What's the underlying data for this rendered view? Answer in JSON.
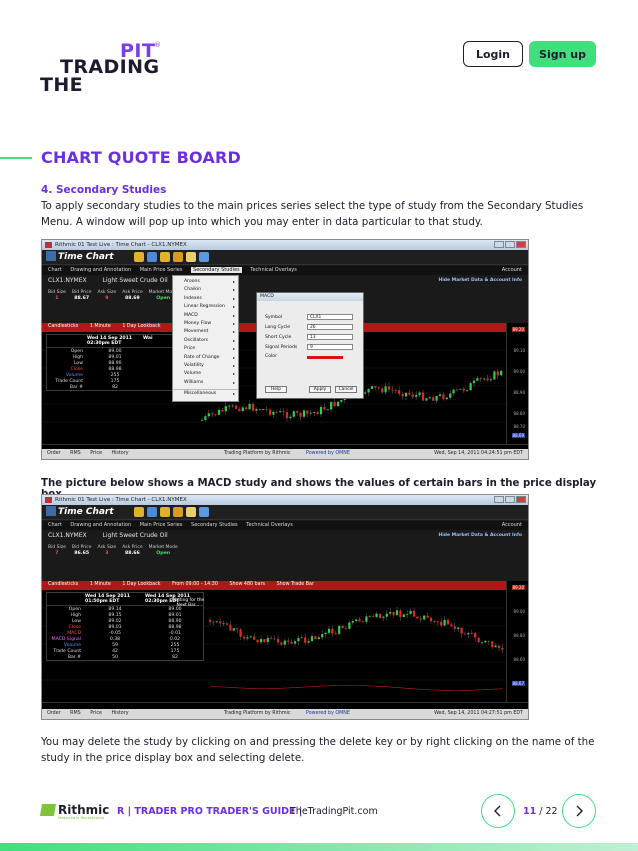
{
  "header": {
    "logo_pit": "PIT",
    "logo_reg": "®",
    "logo_trading": "TRADING",
    "logo_the": "THE",
    "login_label": "Login",
    "signup_label": "Sign up"
  },
  "content": {
    "page_title": "CHART QUOTE BOARD",
    "section_heading": "4. Secondary Studies",
    "paragraph1": "To apply secondary studies to the main prices series select the type  of study  from  the Secondary Studies Menu. A window will pop up into which you may enter in data particular to that study.",
    "caption": "The picture below shows a MACD study and shows the values of certain bars in the price display box.",
    "paragraph2": "You may delete the study by clicking on and pressing the delete key or by right clicking on the name of the study in the price display box and selecting delete."
  },
  "screenshot1": {
    "window_title": "Rithmic 01 Test Live : Time Chart - CLX1.NYMEX",
    "app_name": "Time Chart",
    "menu": [
      "Chart",
      "Drawing and Annotation",
      "Main Price Series",
      "Secondary Studies",
      "Technical Overlays"
    ],
    "menu_account": "Account",
    "symbol": "CLX1.NYMEX",
    "description": "Light Sweet Crude Oil",
    "hide_link": "Hide Market Data & Account Info",
    "quote_labels": [
      "Bid Size",
      "Bid Price",
      "Ask Size",
      "Ask Price",
      "Market Mode"
    ],
    "quote_values": [
      "1",
      "88.67",
      "9",
      "88.69",
      "Open"
    ],
    "ctrl": [
      "Candlesticks",
      "1 Minute",
      "1 Day Lookback"
    ],
    "dropdown_items": [
      "Aroons",
      "Chaikin",
      "Indexes",
      "Linear Regression",
      "MACD",
      "Money Flow",
      "Movement",
      "Oscillators",
      "Price",
      "Rate of Change",
      "Volatility",
      "Volume",
      "Williams",
      "Miscellaneous"
    ],
    "dialog": {
      "title": "MACD",
      "symbol_label": "Symbol",
      "symbol_value": "CLX1",
      "long_label": "Long Cycle",
      "long_value": "26",
      "short_label": "Short Cycle",
      "short_value": "13",
      "signal_label": "Signal Periods",
      "signal_value": "9",
      "color_label": "Color",
      "help": "Help",
      "apply": "Apply",
      "cancel": "Cancel"
    },
    "pricebox": {
      "col1": "Wed 14 Sep 2011 02:30pm EDT",
      "col2": "Wai",
      "rows": [
        [
          "Open",
          "89.00"
        ],
        [
          "High",
          "89.01"
        ],
        [
          "Low",
          "88.90"
        ],
        [
          "Close",
          "88.98"
        ],
        [
          "Volume",
          "255"
        ],
        [
          "Trade Count",
          "175"
        ],
        [
          "Bar #",
          "82"
        ]
      ]
    },
    "axis": [
      "89.20",
      "89.10",
      "89.00",
      "88.90",
      "88.80",
      "88.70",
      "88.69"
    ],
    "status": [
      "Order",
      "RMS",
      "Price",
      "History"
    ],
    "status_mid": "Trading Platform by Rithmic",
    "status_mid2": "Powered by OMNE",
    "status_right": "Wed, Sep 14, 2011 04:24:51 pm EDT"
  },
  "screenshot2": {
    "window_title": "Rithmic 01 Test Live : Time Chart - CLX1.NYMEX",
    "app_name": "Time Chart",
    "menu": [
      "Chart",
      "Drawing and Annotation",
      "Main Price Series",
      "Secondary Studies",
      "Technical Overlays"
    ],
    "menu_account": "Account",
    "symbol": "CLX1.NYMEX",
    "description": "Light Sweet Crude Oil",
    "hide_link": "Hide Market Data & Account Info",
    "quote_labels": [
      "Bid Size",
      "Bid Price",
      "Ask Size",
      "Ask Price",
      "Market Mode"
    ],
    "quote_values": [
      "7",
      "86.65",
      "3",
      "88.66",
      "Open"
    ],
    "ctrl": [
      "Candlesticks",
      "1 Minute",
      "1 Day Lookback",
      "From 09:00 - 14:30",
      "Show 480 bars",
      "Show Trade Bar"
    ],
    "pricebox": {
      "col1": "Wed 14 Sep 2011 01:50pm EDT",
      "col2": "Wed 14 Sep 2011 02:30pm EDT",
      "col3": "Waiting for the Next Bar...",
      "rows": [
        [
          "Open",
          "89.14",
          "89.00"
        ],
        [
          "High",
          "89.15",
          "89.01"
        ],
        [
          "Low",
          "89.02",
          "88.90"
        ],
        [
          "Close",
          "89.03",
          "88.98"
        ],
        [
          "MACD",
          "-0.05",
          "-0.01"
        ],
        [
          "MACD Signal",
          "0.38",
          "0.02"
        ],
        [
          "Volume",
          "59",
          "255"
        ],
        [
          "Trade Count",
          "42",
          "175"
        ],
        [
          "Bar #",
          "50",
          "82"
        ]
      ]
    },
    "axis": [
      "89.20",
      "89.00",
      "88.80",
      "88.60",
      "88.67"
    ],
    "status": [
      "Order",
      "RMS",
      "Price",
      "History"
    ],
    "status_mid": "Trading Platform by Rithmic",
    "status_mid2": "Powered by OMNE",
    "status_right": "Wed, Sep 14, 2011 04:27:51 pm EDT"
  },
  "footer": {
    "brand": "Rithmic",
    "brand_sub": "Measured in Microseconds",
    "guide": "R | TRADER PRO TRADER'S GUIDE |",
    "site": "TheTradingPit.com",
    "page_current": "11",
    "page_sep": " / ",
    "page_total": "22"
  },
  "colors": {
    "accent_purple": "#6b2fe0",
    "accent_green": "#3fe07c",
    "text_dark": "#1d1d2c"
  }
}
